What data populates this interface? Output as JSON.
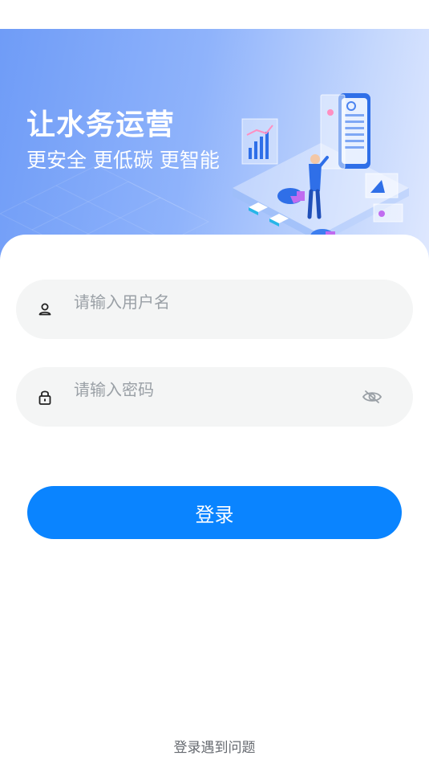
{
  "hero": {
    "title": "让水务运营",
    "subtitle": "更安全 更低碳 更智能"
  },
  "form": {
    "username": {
      "value": "",
      "placeholder": "请输入用户名",
      "icon": "user-icon"
    },
    "password": {
      "value": "",
      "placeholder": "请输入密码",
      "icon": "lock-icon",
      "toggle_icon": "eye-off-icon"
    },
    "login_label": "登录"
  },
  "footer": {
    "help_label": "登录遇到问题"
  },
  "colors": {
    "primary": "#0a84ff",
    "field_bg": "#f4f5f5",
    "placeholder": "#9aa0a6",
    "hero_start": "#6f9cf7",
    "hero_end": "#dfe8fe"
  }
}
